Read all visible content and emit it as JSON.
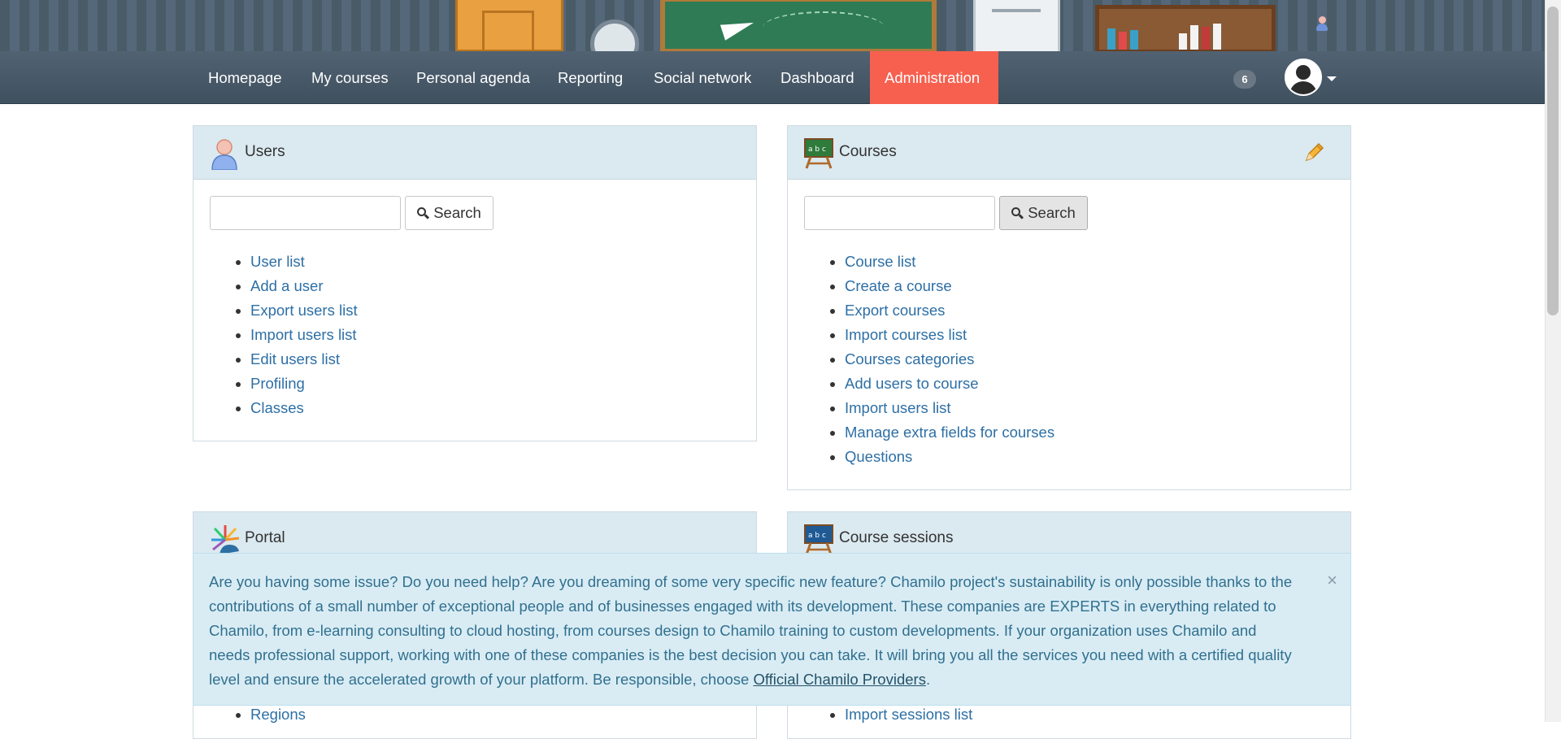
{
  "nav": {
    "items": [
      {
        "label": "Homepage"
      },
      {
        "label": "My courses"
      },
      {
        "label": "Personal agenda"
      },
      {
        "label": "Reporting"
      },
      {
        "label": "Social network"
      },
      {
        "label": "Dashboard"
      },
      {
        "label": "Administration",
        "active": true
      }
    ],
    "notification_count": "6"
  },
  "panels": {
    "users": {
      "title": "Users",
      "search_label": "Search",
      "links": [
        "User list",
        "Add a user",
        "Export users list",
        "Import users list",
        "Edit users list",
        "Profiling",
        "Classes"
      ]
    },
    "courses": {
      "title": "Courses",
      "search_label": "Search",
      "links": [
        "Course list",
        "Create a course",
        "Export courses",
        "Import courses list",
        "Courses categories",
        "Add users to course",
        "Import users list",
        "Manage extra fields for courses",
        "Questions"
      ]
    },
    "portal": {
      "title": "Portal",
      "links": [
        "Regions"
      ]
    },
    "sessions": {
      "title": "Course sessions",
      "links": [
        "Import sessions list"
      ]
    }
  },
  "alert": {
    "text": "Are you having some issue? Do you need help? Are you dreaming of some very specific new feature? Chamilo project's sustainability is only possible thanks to the contributions of a small number of exceptional people and of businesses engaged with its development. These companies are EXPERTS in everything related to Chamilo, from e-learning consulting to cloud hosting, from courses design to Chamilo training to custom developments. If your organization uses Chamilo and needs professional support, working with one of these companies is the best decision you can take. It will bring you all the services you need with a certified quality level and ensure the accelerated growth of your platform. Be responsible, choose ",
    "link_text": "Official Chamilo Providers",
    "suffix": ".",
    "close": "×"
  },
  "colors": {
    "nav_bg": "#46586a",
    "nav_active": "#f7604f",
    "panel_head": "#dbe9f0",
    "link": "#2d6fa5",
    "alert_bg": "#d9ecf4",
    "alert_text": "#31708f"
  },
  "icons": {
    "users": "user-icon",
    "courses": "blackboard-icon",
    "portal": "portal-icon",
    "sessions": "blackboard-icon",
    "edit": "pencil-icon",
    "search": "search-icon",
    "close": "close-icon"
  }
}
